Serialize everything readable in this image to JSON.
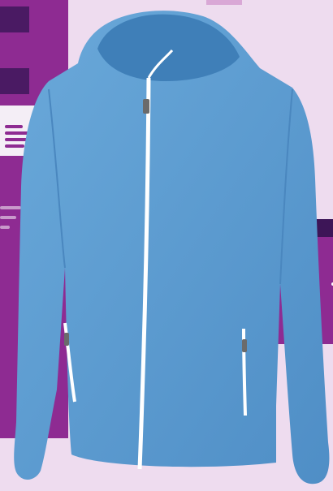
{
  "colors": {
    "background": "#eedcef",
    "purple": "#8e2b92",
    "dark_purple": "#4a1a63",
    "header_purple": "#3d1557",
    "card_white": "#f4eef6",
    "jacket_blue": "#5a9bd0",
    "zipper": "#ffffff"
  },
  "icons": {
    "menu": "hamburger-menu-icon",
    "window_dots": "ellipsis-icon",
    "user": "user-icon"
  }
}
